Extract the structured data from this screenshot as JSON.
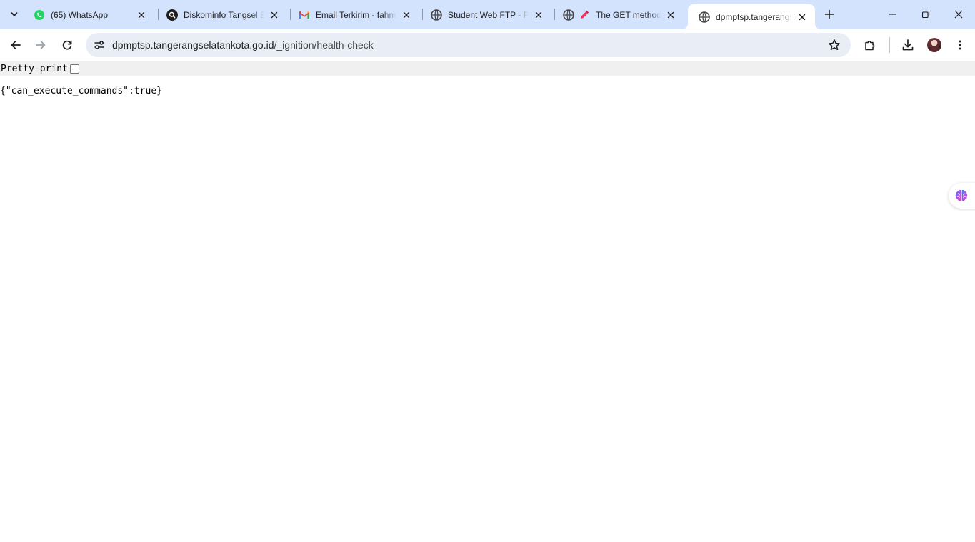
{
  "tabs": [
    {
      "title": "(65) WhatsApp",
      "icon": "whatsapp-icon",
      "active": false
    },
    {
      "title": "Diskominfo Tangsel B",
      "icon": "search-icon",
      "active": false
    },
    {
      "title": "Email Terkirim - fahm",
      "icon": "gmail-icon",
      "active": false
    },
    {
      "title": "Student Web FTP - Pu",
      "icon": "globe-icon",
      "active": false
    },
    {
      "title": "The GET method",
      "icon": "pen-icon",
      "active": false
    },
    {
      "title": "dpmptsp.tangerangse",
      "icon": "globe-icon",
      "active": true
    }
  ],
  "address_bar": {
    "host": "dpmptsp.tangerangselatankota.go.id",
    "path": "/_ignition/health-check"
  },
  "viewer": {
    "pretty_print_label": "Pretty-print",
    "pretty_print_checked": false,
    "json_text": "{\"can_execute_commands\":true}"
  },
  "colors": {
    "tabstrip_bg": "#d3e3fd",
    "omnibox_bg": "#e9eef6",
    "whatsapp_green": "#25d366"
  }
}
